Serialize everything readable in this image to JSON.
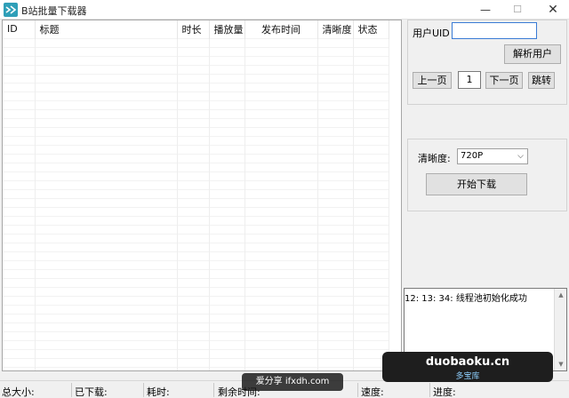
{
  "window": {
    "title": "B站批量下载器",
    "minimize_glyph": "—",
    "maximize_glyph": "☐",
    "close_glyph": "✕",
    "icon": "bilibili-app-icon"
  },
  "table": {
    "columns": [
      "ID",
      "标题",
      "时长",
      "播放量",
      "发布时间",
      "清晰度",
      "状态"
    ],
    "rows": []
  },
  "user_panel": {
    "uid_label": "用户UID",
    "uid_value": "",
    "parse_button": "解析用户",
    "prev_button": "上一页",
    "page_value": "1",
    "next_button": "下一页",
    "jump_button": "跳转"
  },
  "download_panel": {
    "quality_label": "清晰度:",
    "quality_selected": "720P",
    "start_button": "开始下载"
  },
  "log": {
    "lines": [
      "12: 13: 34: 线程池初始化成功"
    ]
  },
  "status": {
    "total_size": "总大小:",
    "downloaded": "已下载:",
    "elapsed": "耗时:",
    "remaining": "剩余时间:",
    "speed": "速度:",
    "progress": "进度:"
  },
  "watermarks": {
    "ifxdh": "爱分享 ifxdh.com",
    "duobaoku_main": "duobaoku.cn",
    "duobaoku_sub": "多宝库"
  }
}
